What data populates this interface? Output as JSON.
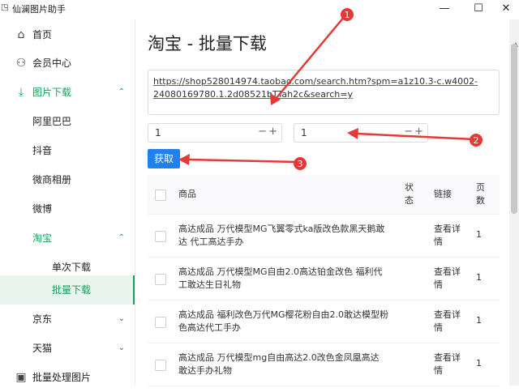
{
  "window": {
    "title": "仙澜图片助手",
    "app_icon": "◳",
    "controls": {
      "minimize": "—",
      "maximize": "☐",
      "close": "✕"
    }
  },
  "sidebar": {
    "items": [
      {
        "label": "首页",
        "icon": "home-icon",
        "glyph": "⌂"
      },
      {
        "label": "会员中心",
        "icon": "user-icon",
        "glyph": "⚇"
      },
      {
        "label": "图片下载",
        "icon": "download-icon",
        "glyph": "⤓",
        "expanded": true
      },
      {
        "label": "阿里巴巴"
      },
      {
        "label": "抖音"
      },
      {
        "label": "微商相册"
      },
      {
        "label": "微博"
      },
      {
        "label": "淘宝",
        "expanded": true
      },
      {
        "label": "单次下载"
      },
      {
        "label": "批量下载",
        "active": true
      },
      {
        "label": "京东"
      },
      {
        "label": "天猫"
      },
      {
        "label": "批量处理图片",
        "icon": "image-icon",
        "glyph": "▣"
      }
    ],
    "chevron_up": "⌃",
    "chevron_down": "⌄"
  },
  "main": {
    "title": "淘宝 - 批量下载",
    "url_lines": [
      "https://shop528014974.taobao.com/search.htm?spm=a1z10.3-c.w4002-",
      "24080169780.1.2d08521bTTah2c&search=y"
    ],
    "start_page": "1",
    "end_page": "1",
    "stepper_minus": "−",
    "stepper_plus": "+",
    "fetch_button": "获取",
    "table": {
      "headers": {
        "product": "商品",
        "status": "状态",
        "link": "链接",
        "pages": "页数"
      },
      "rows": [
        {
          "product": "高达成品 万代模型MG飞翼零式ka版改色款黑天鹅敢达 代工高达手办",
          "link": "查看详情",
          "pages": "1"
        },
        {
          "product": "高达成品 万代模型MG自由2.0高达铂金改色 福利代工敢达生日礼物",
          "link": "查看详情",
          "pages": "1"
        },
        {
          "product": "高达成品 福利改色万代MG樱花粉自由2.0敢达模型粉色高达代工手办",
          "link": "查看详情",
          "pages": "1"
        },
        {
          "product": "高达成品 万代模型mg自由高达2.0改色金凤凰高达 敢达手办礼物",
          "link": "查看详情",
          "pages": "1"
        }
      ]
    }
  },
  "annotations": {
    "labels": [
      "1",
      "2",
      "3"
    ],
    "color": "#e53935"
  }
}
